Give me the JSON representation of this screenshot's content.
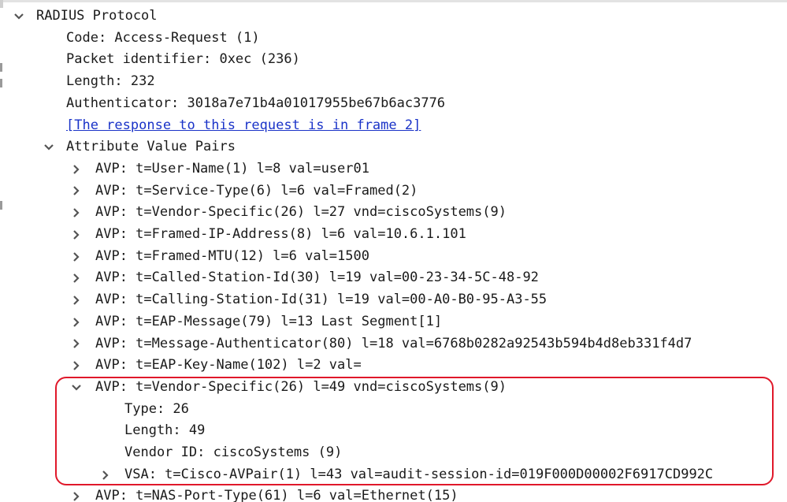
{
  "tree": {
    "root": {
      "label": "RADIUS Protocol",
      "expanded": true
    },
    "fields": [
      "Code: Access-Request (1)",
      "Packet identifier: 0xec (236)",
      "Length: 232",
      "Authenticator: 3018a7e71b4a01017955be67b6ac3776"
    ],
    "response_link": "[The response to this request is in frame 2]",
    "avp_group": {
      "label": "Attribute Value Pairs",
      "expanded": true
    },
    "avps": [
      "AVP: t=User-Name(1) l=8 val=user01",
      "AVP: t=Service-Type(6) l=6 val=Framed(2)",
      "AVP: t=Vendor-Specific(26) l=27 vnd=ciscoSystems(9)",
      "AVP: t=Framed-IP-Address(8) l=6 val=10.6.1.101",
      "AVP: t=Framed-MTU(12) l=6 val=1500",
      "AVP: t=Called-Station-Id(30) l=19 val=00-23-34-5C-48-92",
      "AVP: t=Calling-Station-Id(31) l=19 val=00-A0-B0-95-A3-55",
      "AVP: t=EAP-Message(79) l=13 Last Segment[1]",
      "AVP: t=Message-Authenticator(80) l=18 val=6768b0282a92543b594b4d8eb331f4d7",
      "AVP: t=EAP-Key-Name(102) l=2 val="
    ],
    "highlighted_avp": {
      "label": "AVP: t=Vendor-Specific(26) l=49 vnd=ciscoSystems(9)",
      "expanded": true,
      "children": [
        "Type: 26",
        "Length: 49",
        "Vendor ID: ciscoSystems (9)"
      ],
      "vsa": "VSA: t=Cisco-AVPair(1) l=43 val=audit-session-id=019F000D00002F6917CD992C"
    },
    "next_avp": "AVP: t=NAS-Port-Type(61) l=6 val=Ethernet(15)"
  },
  "colors": {
    "text": "#1a1a1a",
    "link": "#1a33c8",
    "highlight_border": "#e0182a",
    "twisty": "#555555"
  },
  "icons": {
    "expanded": "chevron-down-icon",
    "collapsed": "chevron-right-icon"
  }
}
